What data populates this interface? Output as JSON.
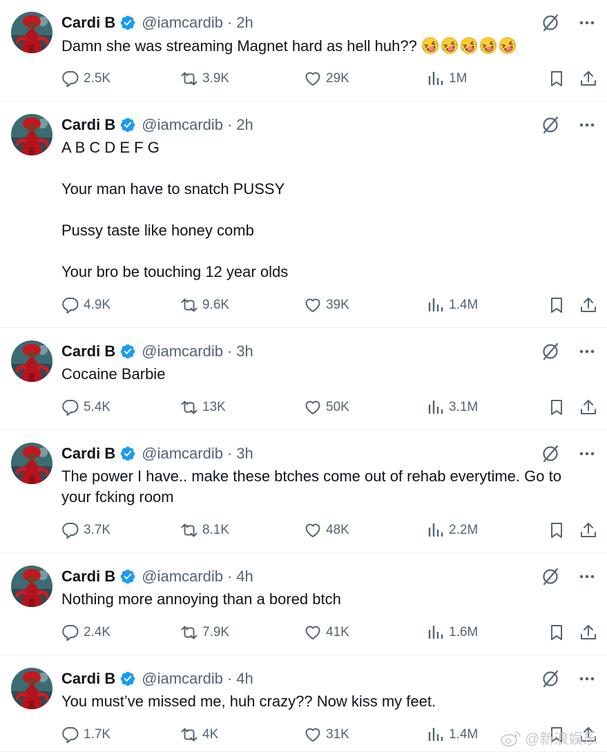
{
  "tweets": [
    {
      "author": "Cardi B",
      "handle": "@iamcardib",
      "separator": "·",
      "time": "2h",
      "text": "Damn she was streaming Magnet hard as hell huh?? ",
      "emoji": "rolling-on-floor-laughing x5",
      "replies": "2.5K",
      "reposts": "3.9K",
      "likes": "29K",
      "views": "1M"
    },
    {
      "author": "Cardi B",
      "handle": "@iamcardib",
      "separator": "·",
      "time": "2h",
      "text": "A B C D E F G\n\nYour man have to snatch PUSSY\n\nPussy taste like honey comb\n\nYour bro be touching 12 year olds",
      "replies": "4.9K",
      "reposts": "9.6K",
      "likes": "39K",
      "views": "1.4M"
    },
    {
      "author": "Cardi B",
      "handle": "@iamcardib",
      "separator": "·",
      "time": "3h",
      "text": "Cocaine Barbie",
      "replies": "5.4K",
      "reposts": "13K",
      "likes": "50K",
      "views": "3.1M"
    },
    {
      "author": "Cardi B",
      "handle": "@iamcardib",
      "separator": "·",
      "time": "3h",
      "text": "The power I have.. make these btches come out of rehab everytime. Go to your fcking room",
      "replies": "3.7K",
      "reposts": "8.1K",
      "likes": "48K",
      "views": "2.2M"
    },
    {
      "author": "Cardi B",
      "handle": "@iamcardib",
      "separator": "·",
      "time": "4h",
      "text": "Nothing more annoying than a bored btch",
      "replies": "2.4K",
      "reposts": "7.9K",
      "likes": "41K",
      "views": "1.6M"
    },
    {
      "author": "Cardi B",
      "handle": "@iamcardib",
      "separator": "·",
      "time": "4h",
      "text": "You must’ve missed me, huh crazy?? Now kiss my feet.",
      "replies": "1.7K",
      "reposts": "4K",
      "likes": "31K",
      "views": "1.4M"
    }
  ],
  "watermark": "@新浪娱乐",
  "colors": {
    "text": "#0f1419",
    "secondary": "#536471",
    "verified": "#1d9bf0",
    "divider": "#eff3f4"
  },
  "icons": [
    "verified-badge-icon",
    "grok-icon",
    "more-icon",
    "reply-icon",
    "repost-icon",
    "like-icon",
    "views-icon",
    "bookmark-icon",
    "share-icon",
    "weibo-logo-icon"
  ]
}
